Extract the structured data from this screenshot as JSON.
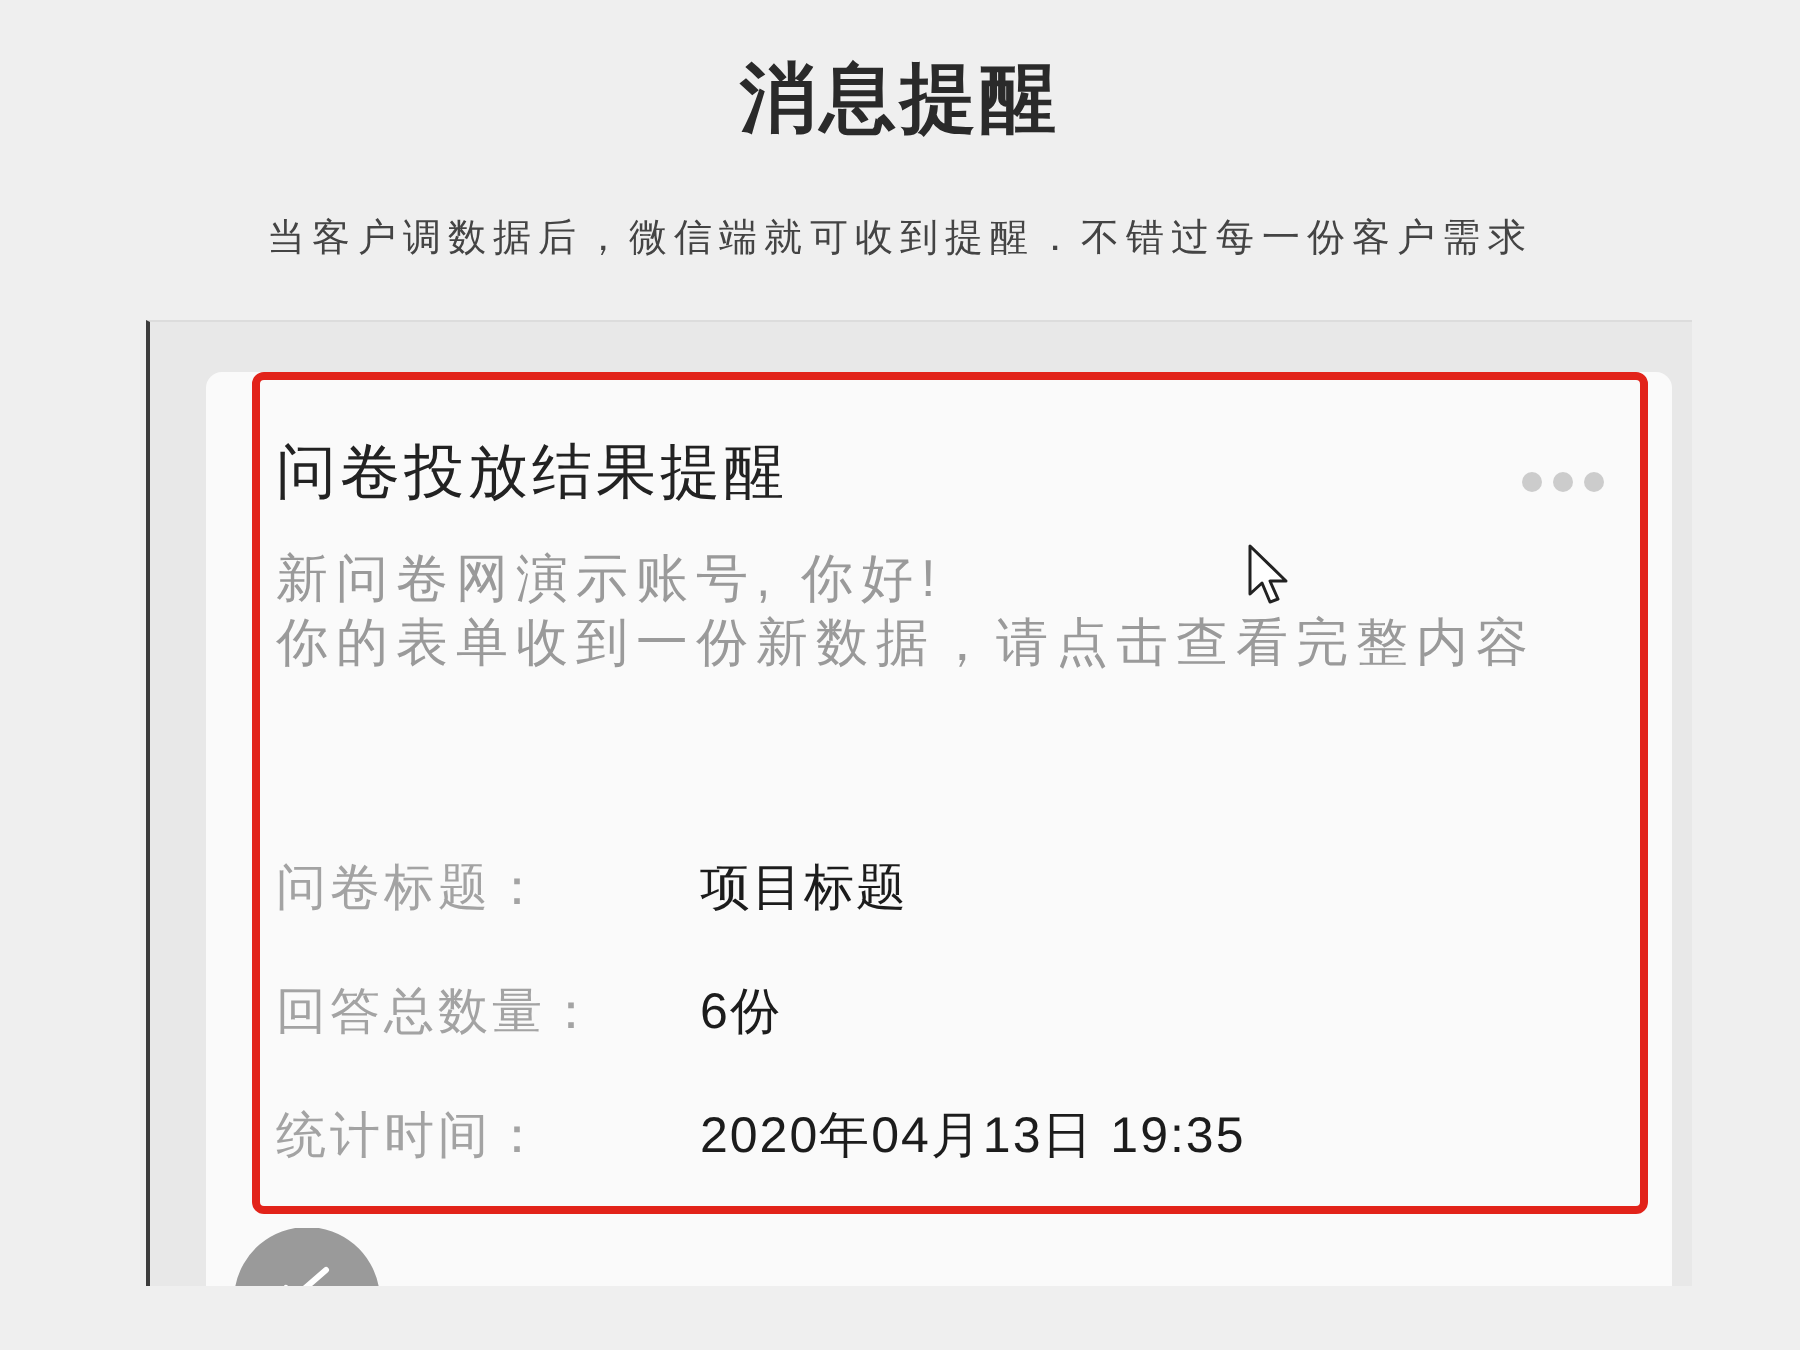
{
  "header": {
    "title": "消息提醒",
    "subtitle": "当客户调数据后，微信端就可收到提醒．不错过每一份客户需求"
  },
  "message_card": {
    "highlighted": true,
    "title": "问卷投放结果提醒",
    "greeting": "新问卷网演示账号, 你好!",
    "body": "你的表单收到一份新数据，请点击查看完整内容",
    "fields": [
      {
        "label": "问卷标题：",
        "value": "项目标题"
      },
      {
        "label": "回答总数量：",
        "value": "6份"
      },
      {
        "label": "统计时间：",
        "value": "2020年04月13日 19:35"
      }
    ]
  }
}
